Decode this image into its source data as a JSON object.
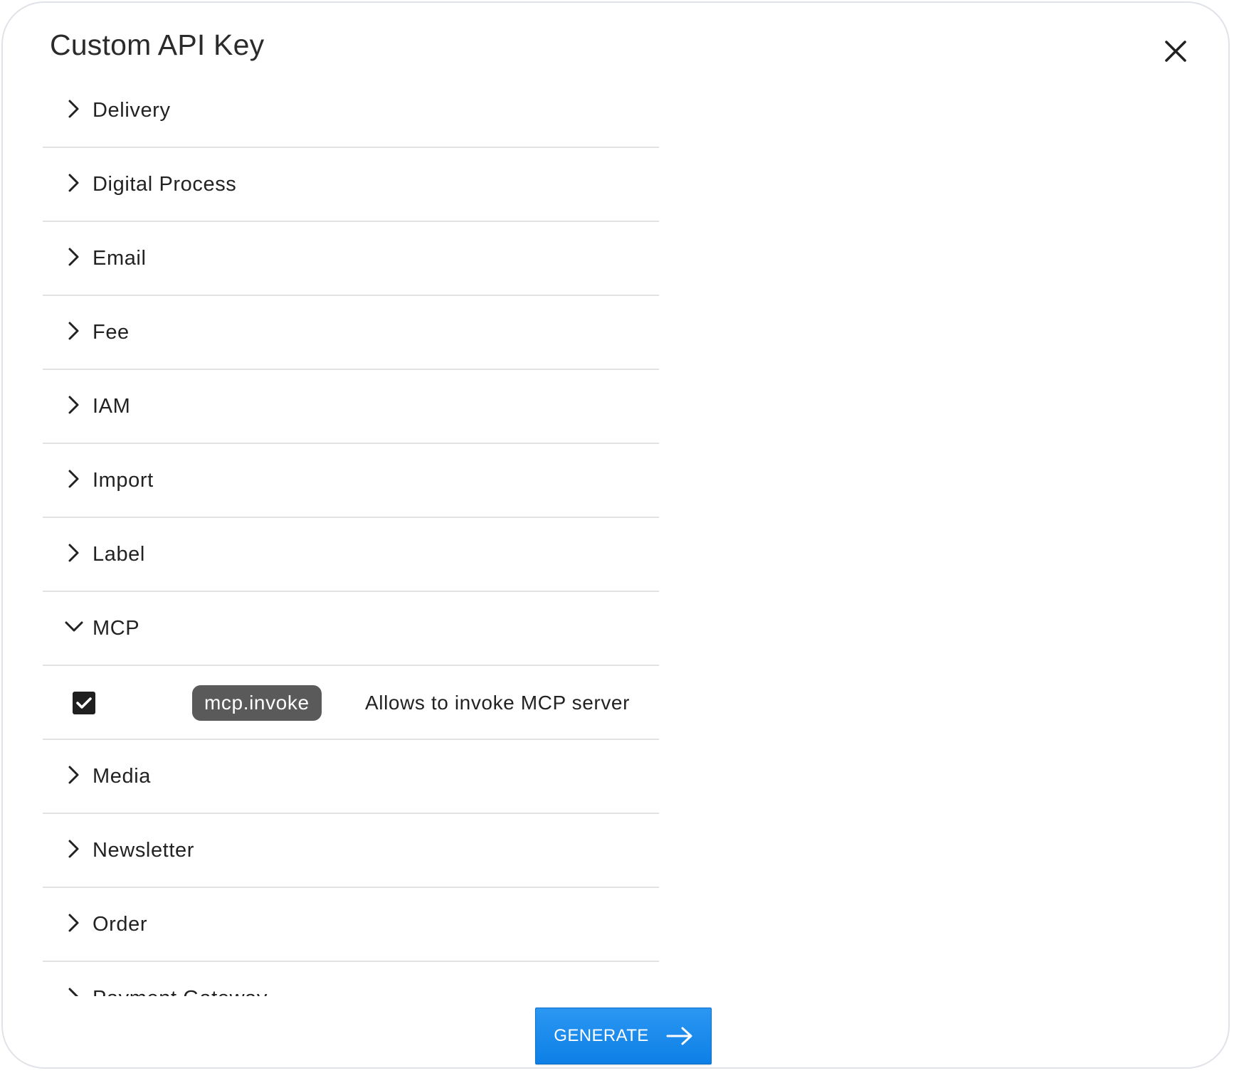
{
  "dialog": {
    "title": "Custom API Key",
    "close_icon": "close-icon"
  },
  "categories": [
    {
      "label": "Delivery",
      "expanded": false
    },
    {
      "label": "Digital Process",
      "expanded": false
    },
    {
      "label": "Email",
      "expanded": false
    },
    {
      "label": "Fee",
      "expanded": false
    },
    {
      "label": "IAM",
      "expanded": false
    },
    {
      "label": "Import",
      "expanded": false
    },
    {
      "label": "Label",
      "expanded": false
    },
    {
      "label": "MCP",
      "expanded": true
    },
    {
      "label": "Media",
      "expanded": false
    },
    {
      "label": "Newsletter",
      "expanded": false
    },
    {
      "label": "Order",
      "expanded": false
    },
    {
      "label": "Payment Gateway",
      "expanded": false
    }
  ],
  "mcp_permission": {
    "checked": true,
    "scope": "mcp.invoke",
    "description": "Allows to invoke MCP server"
  },
  "footer": {
    "generate_label": "GENERATE",
    "generate_icon": "arrow-right-icon"
  },
  "colors": {
    "primary": "#1a8cf0",
    "chip": "#5a5a5a",
    "checkbox": "#1f1f1f",
    "divider": "#e2e2e2"
  }
}
